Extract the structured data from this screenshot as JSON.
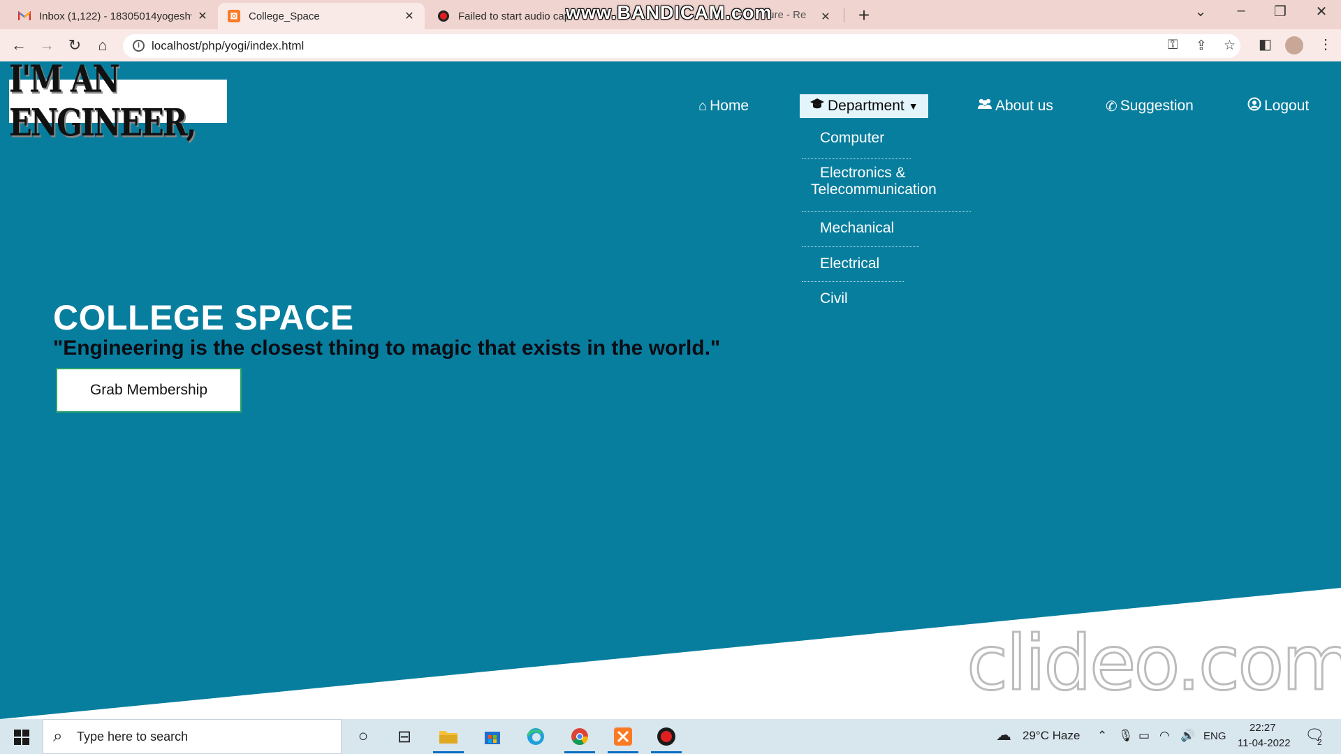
{
  "browser": {
    "tabs": [
      {
        "title": "Inbox (1,122) - 18305014yogeshw",
        "favicon": "gmail-icon"
      },
      {
        "title": "College_Space",
        "favicon": "xampp-icon"
      },
      {
        "title": "Failed to start audio cap",
        "title_tail": "ture - Re",
        "favicon": "record-icon"
      }
    ],
    "watermark_top": "www.BANDICAM.com",
    "url": "localhost/php/yogi/index.html"
  },
  "page": {
    "logo_text": "I'M AN ENGINEER,",
    "nav": [
      {
        "label": "Home",
        "icon": "home-icon"
      },
      {
        "label": "Department",
        "icon": "graduation-cap-icon"
      },
      {
        "label": "About us",
        "icon": "users-icon"
      },
      {
        "label": "Suggestion",
        "icon": "phone-icon"
      },
      {
        "label": "Logout",
        "icon": "user-circle-icon"
      }
    ],
    "dropdown": [
      {
        "label": "Computer"
      },
      {
        "label": "Electronics &",
        "label2": "Telecommunication"
      },
      {
        "label": "Mechanical"
      },
      {
        "label": "Electrical"
      },
      {
        "label": "Civil"
      }
    ],
    "hero_title": "COLLEGE SPACE",
    "hero_quote": "\"Engineering is the closest thing to magic that exists in the world.\"",
    "cta_label": "Grab Membership",
    "watermark_bottom": "clideo.com",
    "colors": {
      "background": "#087e9e",
      "active_nav_bg": "#e3f4fa",
      "cta_border": "#2aa26a"
    }
  },
  "taskbar": {
    "search_placeholder": "Type here to search",
    "weather": "29°C  Haze",
    "lang": "ENG",
    "time": "22:27",
    "date": "11-04-2022",
    "notifications": "2"
  }
}
